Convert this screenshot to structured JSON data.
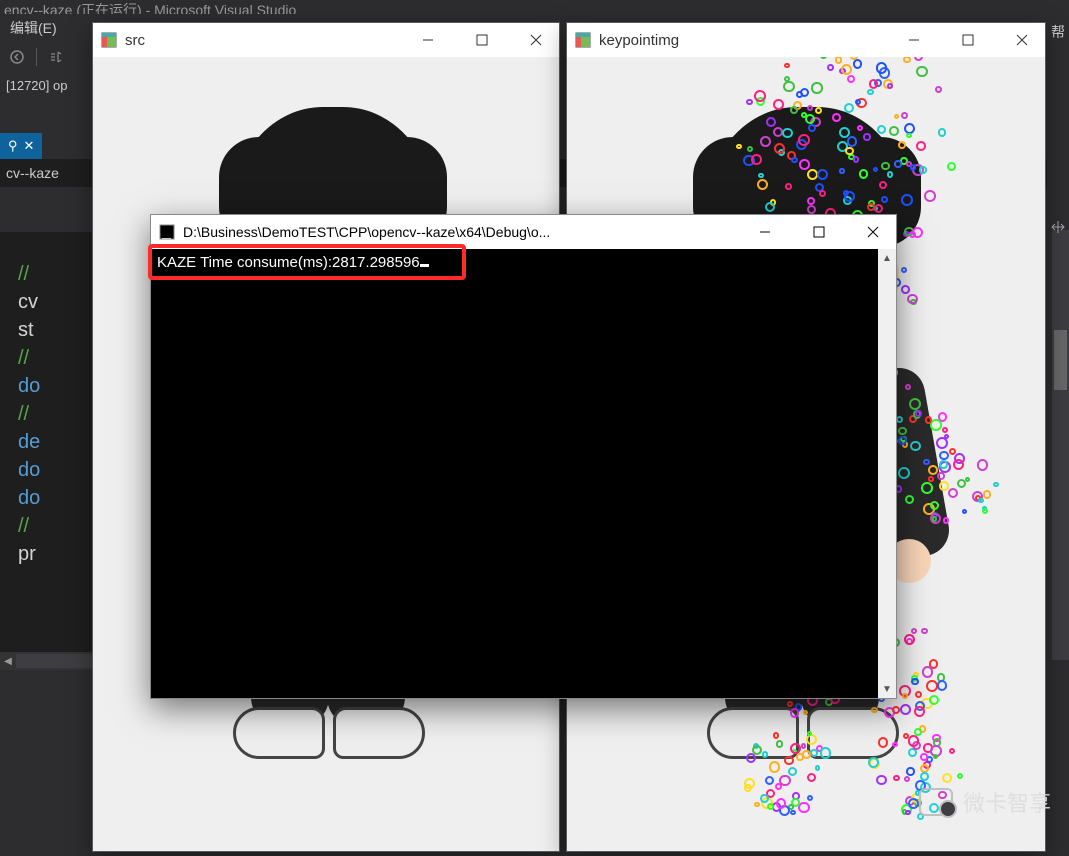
{
  "vs": {
    "title_fragment": "encv--kaze (正在运行) - Microsoft Visual Studio",
    "menu_edit": "编辑(E)",
    "right_menu_help": "帮",
    "process_label": "[12720] op",
    "tab_label": "",
    "tab_pin": "⚲",
    "tab_close": "✕",
    "file_label": "cv--kaze"
  },
  "code": {
    "l1": "//",
    "l2": "cv",
    "l3": "st",
    "l4": "//",
    "l5": "do",
    "l6": "//",
    "l7": "de",
    "l8": "do",
    "l9": "do",
    "l10": "//",
    "l11": "pr"
  },
  "src_window": {
    "title": "src"
  },
  "kp_window": {
    "title": "keypointimg"
  },
  "console": {
    "title": "D:\\Business\\DemoTEST\\CPP\\opencv--kaze\\x64\\Debug\\o...",
    "line1": "KAZE Time consume(ms):2817.298596"
  },
  "watermark": {
    "text": "微卡智享"
  }
}
